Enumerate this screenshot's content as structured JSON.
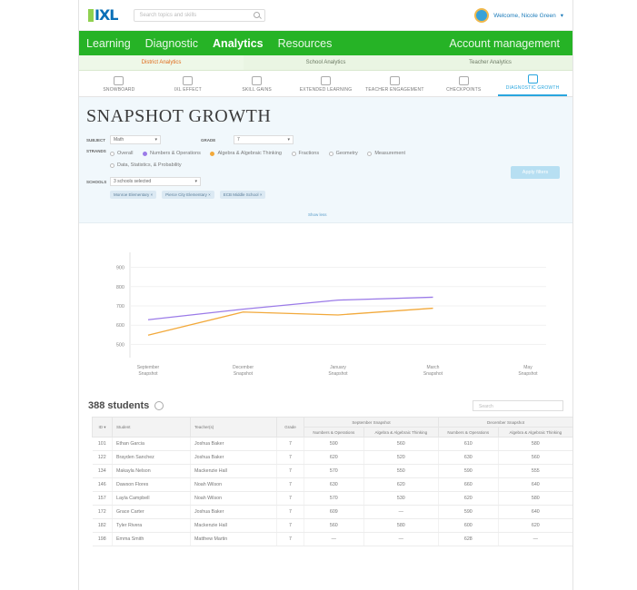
{
  "topbar": {
    "logo": "IXL",
    "search_placeholder": "Search topics and skills",
    "user_greeting": "Welcome, Nicole Green"
  },
  "mainnav": {
    "items": [
      "Learning",
      "Diagnostic",
      "Analytics",
      "Resources"
    ],
    "active": "Analytics",
    "account": "Account management"
  },
  "subtabs": [
    "District Analytics",
    "School Analytics",
    "Teacher Analytics"
  ],
  "reportnav": [
    "SNOWBOARD",
    "IXL EFFECT",
    "SKILL GAINS",
    "EXTENDED LEARNING",
    "TEACHER ENGAGEMENT",
    "CHECKPOINTS",
    "DIAGNOSTIC GROWTH"
  ],
  "page": {
    "title": "SNAPSHOT GROWTH",
    "subject_label": "SUBJECT",
    "subject_value": "Math",
    "grade_label": "GRADE",
    "grade_value": "7",
    "strands_label": "STRANDS",
    "strands": [
      "Overall",
      "Numbers & Operations",
      "Algebra & Algebraic Thinking",
      "Fractions",
      "Geometry",
      "Measurement",
      "Data, Statistics, & Probability"
    ],
    "schools_label": "SCHOOLS",
    "schools_value": "3 schools selected",
    "school_chips": [
      "Monroe Elementary",
      "Pierce City Elementary",
      "ECB Middle School"
    ],
    "apply_label": "Apply filters",
    "show_less": "Show less"
  },
  "chart_data": {
    "type": "line",
    "categories": [
      "September Snapshot",
      "December Snapshot",
      "January Snapshot",
      "March Snapshot",
      "May Snapshot"
    ],
    "series": [
      {
        "name": "Numbers & Operations",
        "color": "#9b7be8",
        "values": [
          628,
          683,
          730,
          745,
          null
        ]
      },
      {
        "name": "Algebra & Algebraic Thinking",
        "color": "#f2a93b",
        "values": [
          548,
          668,
          653,
          688,
          null
        ]
      }
    ],
    "yticks": [
      500,
      600,
      700,
      800,
      900
    ],
    "ylim": [
      450,
      950
    ]
  },
  "table": {
    "count_label": "388 students",
    "search_placeholder": "Search",
    "columns": [
      "ID",
      "Student",
      "Teacher(s)",
      "Grade"
    ],
    "group_headers": [
      "September Snapshot",
      "December Snapshot"
    ],
    "sub_headers": [
      "Numbers & Operations",
      "Algebra & Algebraic Thinking",
      "Numbers & Operations",
      "Algebra & Algebraic Thinking"
    ],
    "rows": [
      [
        "101",
        "Ethan Garcia",
        "Joshua Baker",
        "7",
        "590",
        "560",
        "610",
        "580"
      ],
      [
        "122",
        "Brayden Sanchez",
        "Joshua Baker",
        "7",
        "620",
        "520",
        "630",
        "560"
      ],
      [
        "134",
        "Makayla Nelson",
        "Mackenzie Hall",
        "7",
        "570",
        "550",
        "590",
        "555"
      ],
      [
        "146",
        "Dawson Flores",
        "Noah Wilson",
        "7",
        "630",
        "620",
        "660",
        "640"
      ],
      [
        "157",
        "Layla Campbell",
        "Noah Wilson",
        "7",
        "570",
        "530",
        "620",
        "580"
      ],
      [
        "172",
        "Grace Carter",
        "Joshua Baker",
        "7",
        "609",
        "—",
        "590",
        "640"
      ],
      [
        "182",
        "Tyler Rivera",
        "Mackenzie Hall",
        "7",
        "560",
        "580",
        "600",
        "620"
      ],
      [
        "198",
        "Emma Smith",
        "Matthew Martin",
        "7",
        "—",
        "—",
        "628",
        "—"
      ]
    ]
  }
}
